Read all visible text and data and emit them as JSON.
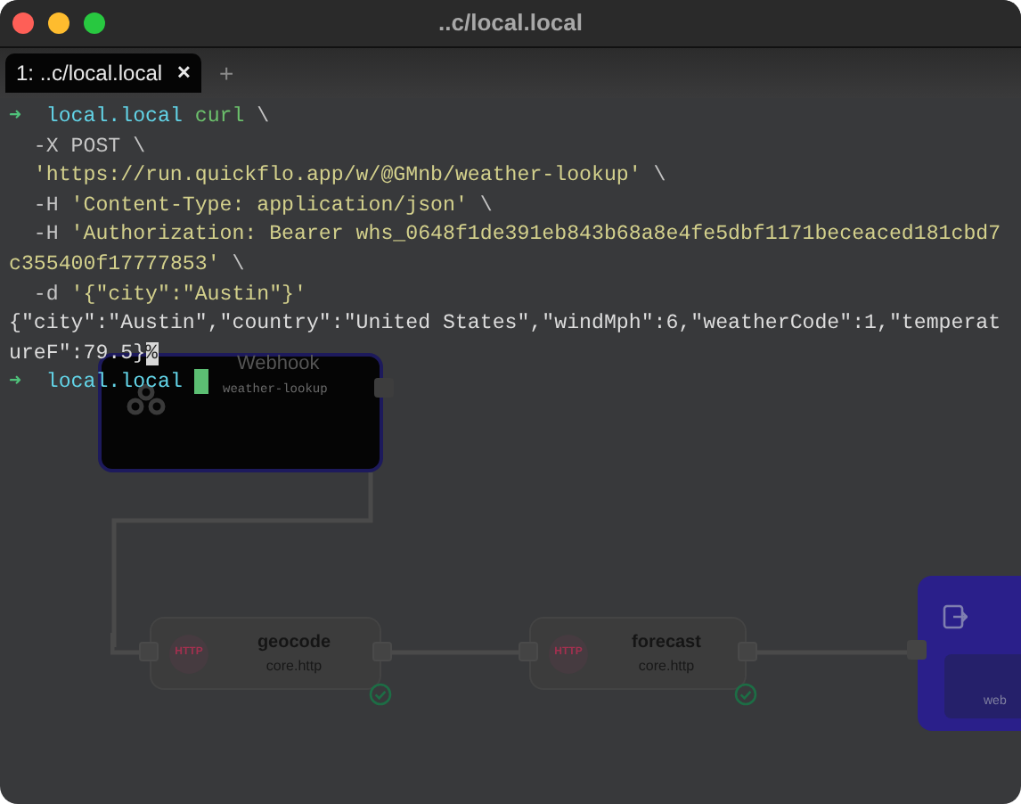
{
  "window": {
    "title": "..c/local.local"
  },
  "tabs": [
    {
      "label": "1: ..c/local.local",
      "selected": true,
      "close": "✕"
    }
  ],
  "new_tab": "+",
  "terminal": {
    "lines": [
      {
        "indent": false,
        "segments": [
          {
            "kind": "arrow",
            "text": "➜"
          },
          {
            "kind": "dir",
            "text": "local.local"
          },
          {
            "kind": "command",
            "text": "curl"
          },
          {
            "kind": "plain",
            "text": "\\"
          }
        ]
      },
      {
        "indent": true,
        "segments": [
          {
            "kind": "plain",
            "text": "-X POST \\"
          }
        ]
      },
      {
        "indent": true,
        "segments": [
          {
            "kind": "string",
            "text": "'https://run.quickflo.app/w/@GMnb/weather-lookup'"
          },
          {
            "kind": "plain",
            "text": "\\"
          }
        ]
      },
      {
        "indent": true,
        "segments": [
          {
            "kind": "plain",
            "text": "-H"
          },
          {
            "kind": "string",
            "text": "'Content-Type: application/json'"
          },
          {
            "kind": "plain",
            "text": "\\"
          }
        ]
      },
      {
        "indent": true,
        "segments": [
          {
            "kind": "plain",
            "text": "-H"
          },
          {
            "kind": "string",
            "text": "'Authorization: Bearer whs_0648f1de391eb843b68a8e4fe5dbf1171beceaced181cbd7"
          }
        ]
      },
      {
        "indent": false,
        "segments": [
          {
            "kind": "string",
            "text": "c355400f17777853'"
          },
          {
            "kind": "plain",
            "text": "\\"
          }
        ]
      },
      {
        "indent": true,
        "segments": [
          {
            "kind": "plain",
            "text": "-d"
          },
          {
            "kind": "string",
            "text": "'{\"city\":\"Austin\"}'"
          }
        ]
      },
      {
        "indent": false,
        "segments": [
          {
            "kind": "output",
            "text": "{\"city\":\"Austin\",\"country\":\"United States\",\"windMph\":6,\"weatherCode\":1,\"temperat"
          }
        ]
      },
      {
        "indent": false,
        "segments": [
          {
            "kind": "output",
            "text": "ureF\":79.5}"
          },
          {
            "kind": "inverse",
            "text": "%"
          }
        ]
      },
      {
        "indent": false,
        "segments": [
          {
            "kind": "arrow",
            "text": "➜"
          },
          {
            "kind": "dir",
            "text": "local.local"
          },
          {
            "kind": "cursor"
          }
        ]
      }
    ]
  },
  "canvas": {
    "nodes": [
      {
        "kind": "webhook",
        "title": "Webhook",
        "subtitle": "weather-lookup"
      },
      {
        "kind": "http",
        "badge": "HTTP",
        "title": "geocode",
        "subtitle": "core.http",
        "completed": true
      },
      {
        "kind": "http",
        "badge": "HTTP",
        "title": "forecast",
        "subtitle": "core.http",
        "completed": true
      },
      {
        "kind": "output",
        "title": "web"
      }
    ]
  }
}
